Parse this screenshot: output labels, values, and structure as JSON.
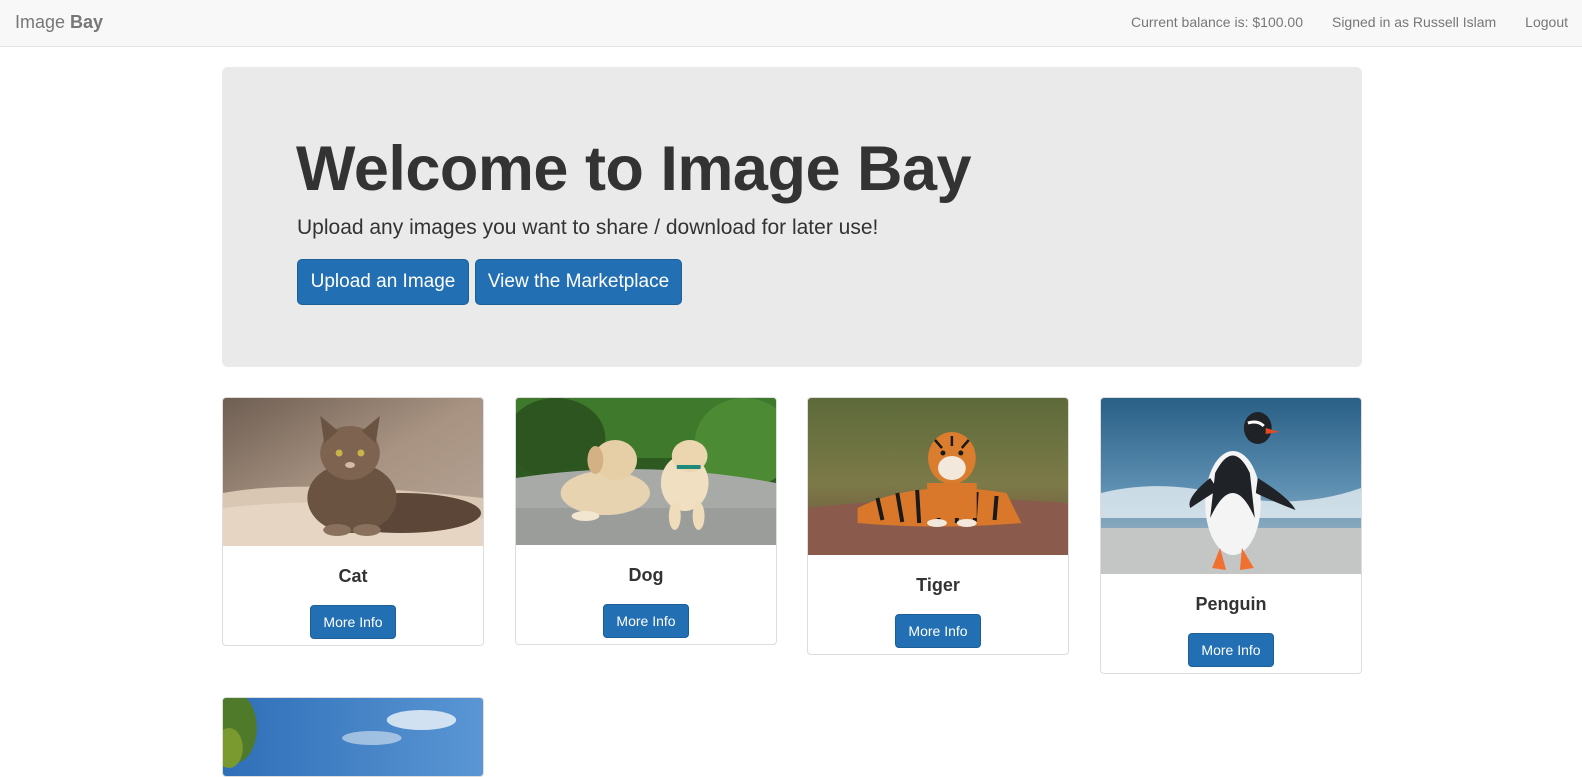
{
  "navbar": {
    "brand_light": "Image ",
    "brand_bold": "Bay",
    "balance": "Current balance is: $100.00",
    "signed_in": "Signed in as Russell Islam",
    "logout": "Logout"
  },
  "hero": {
    "title": "Welcome to Image Bay",
    "subtitle": "Upload any images you want to share / download for later use!",
    "upload_label": "Upload an Image",
    "marketplace_label": "View the Marketplace"
  },
  "cards": [
    {
      "name": "Cat",
      "button": "More Info",
      "image": "cat-photo"
    },
    {
      "name": "Dog",
      "button": "More Info",
      "image": "dog-photo"
    },
    {
      "name": "Tiger",
      "button": "More Info",
      "image": "tiger-photo"
    },
    {
      "name": "Penguin",
      "button": "More Info",
      "image": "penguin-photo"
    },
    {
      "name": "",
      "button": "",
      "image": "landscape-photo"
    }
  ],
  "colors": {
    "primary": "#2270b3",
    "navbar_bg": "#f8f8f8",
    "jumbotron_bg": "#eaeaea"
  }
}
